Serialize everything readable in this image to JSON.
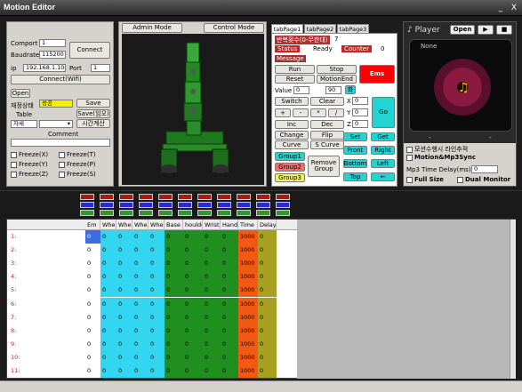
{
  "window": {
    "title": "Motion Editor",
    "minimize": "_",
    "close": "X"
  },
  "connection": {
    "comport_label": "Comport",
    "comport_value": "1",
    "baudrate_label": "Baudrate",
    "baudrate_value": "115200",
    "ip_label": "ip",
    "ip_value": "192.168.1.100",
    "port_label": "Port",
    "port_value": "1",
    "connect_label": "Connect",
    "connect_wifi_label": "Connect(Wifi)",
    "open_label": "Open",
    "state_label": "재정상태",
    "state_value": "성공",
    "save_label": "Save",
    "table_label": "Table",
    "save_table_label": "Save(임오)",
    "select_label": "자세",
    "time_calc_label": "시간계산",
    "comment_label": "Comment",
    "freeze": [
      "Freeze(X)",
      "Freeze(T)",
      "Freeze(Y)",
      "Freeze(P)",
      "Freeze(Z)",
      "Freeze(S)"
    ]
  },
  "view": {
    "admin_mode": "Admin Mode",
    "control_mode": "Control Mode"
  },
  "tabs": [
    "tabPage1",
    "tabPage2",
    "tabPage3"
  ],
  "control": {
    "loop_label": "반복횟수(0-무한대)",
    "loop_value": "7",
    "status_label": "Status",
    "status_value": "Ready",
    "counter_label": "Counter",
    "counter_value": "0",
    "message_label": "Message",
    "run": "Run",
    "stop": "Stop",
    "reset": "Reset",
    "motion_end": "MotionEnd",
    "ems": "Ems",
    "value_label": "Value",
    "value_value": "0",
    "value2": "90",
    "apply": "화",
    "switch": "Switch",
    "clear": "Clear",
    "plus": "+",
    "minus": "-",
    "mul": "*",
    "div": "/",
    "x_label": "X",
    "x_value": "0",
    "y_label": "Y",
    "y_value": "0",
    "z_label": "Z",
    "z_value": "0",
    "inc": "Inc",
    "dec": "Dec",
    "go": "Go",
    "change": "Change",
    "flip": "Flip",
    "set": "Set",
    "get": "Get",
    "curve": "Curve",
    "s_curve": "S Curve",
    "front": "Front",
    "right": "Right",
    "group1": "Group1",
    "group2": "Group2",
    "group3": "Group3",
    "remove_group": "Remove Group",
    "bottom": "Bottom",
    "left": "Left",
    "top": "Top",
    "arrow": "←"
  },
  "player": {
    "title": "Player",
    "open": "Open",
    "play": "▶",
    "stop": "■",
    "track": "None",
    "pos_left": "-",
    "pos_right": "-",
    "option1": "모션수행시 라인추적",
    "option2": "Motion&Mp3Sync",
    "delay_label": "Mp3 Time Delay(ms)",
    "delay_value": "0",
    "full_size": "Full Size",
    "dual_monitor": "Dual Monitor"
  },
  "table": {
    "columns": [
      "Em",
      "Whe",
      "Whe",
      "Whe",
      "Whe",
      "Base",
      "houlde",
      "Wrist",
      "Hand",
      "Time",
      "Delay"
    ],
    "rows": [
      {
        "label": "1:",
        "values": [
          "0",
          "0",
          "0",
          "0",
          "0",
          "0",
          "0",
          "0",
          "0",
          "1000",
          "0"
        ]
      },
      {
        "label": "2:",
        "values": [
          "0",
          "0",
          "0",
          "0",
          "0",
          "0",
          "0",
          "0",
          "0",
          "1000",
          "0"
        ]
      },
      {
        "label": "3:",
        "values": [
          "0",
          "0",
          "0",
          "0",
          "0",
          "0",
          "0",
          "0",
          "0",
          "1000",
          "0"
        ]
      },
      {
        "label": "4:",
        "values": [
          "0",
          "0",
          "0",
          "0",
          "0",
          "0",
          "0",
          "0",
          "0",
          "1000",
          "0"
        ]
      },
      {
        "label": "5:",
        "values": [
          "0",
          "0",
          "0",
          "0",
          "0",
          "0",
          "0",
          "0",
          "0",
          "1000",
          "0"
        ]
      },
      {
        "label": "6:",
        "values": [
          "0",
          "0",
          "0",
          "0",
          "0",
          "0",
          "0",
          "0",
          "0",
          "1000",
          "0"
        ]
      },
      {
        "label": "7:",
        "values": [
          "0",
          "0",
          "0",
          "0",
          "0",
          "0",
          "0",
          "0",
          "0",
          "1000",
          "0"
        ]
      },
      {
        "label": "8:",
        "values": [
          "0",
          "0",
          "0",
          "0",
          "0",
          "0",
          "0",
          "0",
          "0",
          "1000",
          "0"
        ]
      },
      {
        "label": "9:",
        "values": [
          "0",
          "0",
          "0",
          "0",
          "0",
          "0",
          "0",
          "0",
          "0",
          "1000",
          "0"
        ]
      },
      {
        "label": "10:",
        "values": [
          "0",
          "0",
          "0",
          "0",
          "0",
          "0",
          "0",
          "0",
          "0",
          "1000",
          "0"
        ]
      },
      {
        "label": "11:",
        "values": [
          "0",
          "0",
          "0",
          "0",
          "0",
          "0",
          "0",
          "0",
          "0",
          "1000",
          "0"
        ]
      }
    ]
  }
}
